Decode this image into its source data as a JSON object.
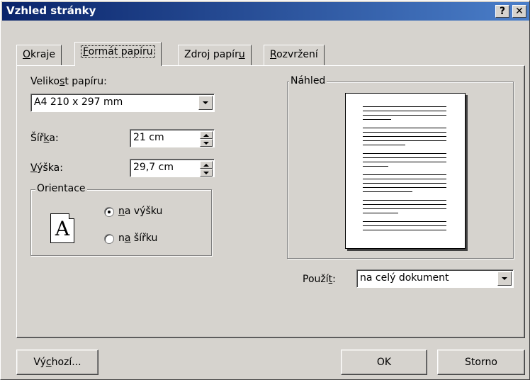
{
  "window": {
    "title": "Vzhled stránky",
    "help_label": "?",
    "close_label": "✕"
  },
  "tabs": [
    {
      "pre": "",
      "key": "O",
      "post": "kraje"
    },
    {
      "pre": "",
      "key": "F",
      "post": "ormát papíru"
    },
    {
      "pre": "Zdroj papír",
      "key": "u",
      "post": ""
    },
    {
      "pre": "",
      "key": "R",
      "post": "ozvržení"
    }
  ],
  "paper": {
    "size_label_pre": "Veliko",
    "size_label_key": "s",
    "size_label_post": "t papíru:",
    "size_value": "A4 210 x 297 mm",
    "width_label_pre": "Šíř",
    "width_label_key": "k",
    "width_label_post": "a:",
    "width_value": "21 cm",
    "height_label_pre": "",
    "height_label_key": "V",
    "height_label_post": "ýška:",
    "height_value": "29,7 cm"
  },
  "orientation": {
    "title": "Orientace",
    "icon_letter": "A",
    "portrait_pre": "",
    "portrait_key": "n",
    "portrait_post": "a výšku",
    "landscape_pre": "n",
    "landscape_key": "a",
    "landscape_post": " šířku",
    "selected": "portrait"
  },
  "preview": {
    "title": "Náhled",
    "apply_label_pre": "Použí",
    "apply_label_key": "t",
    "apply_label_post": ":",
    "apply_value": "na celý dokument"
  },
  "buttons": {
    "default_pre": "Vý",
    "default_key": "c",
    "default_post": "hozí...",
    "ok": "OK",
    "cancel": "Storno"
  }
}
